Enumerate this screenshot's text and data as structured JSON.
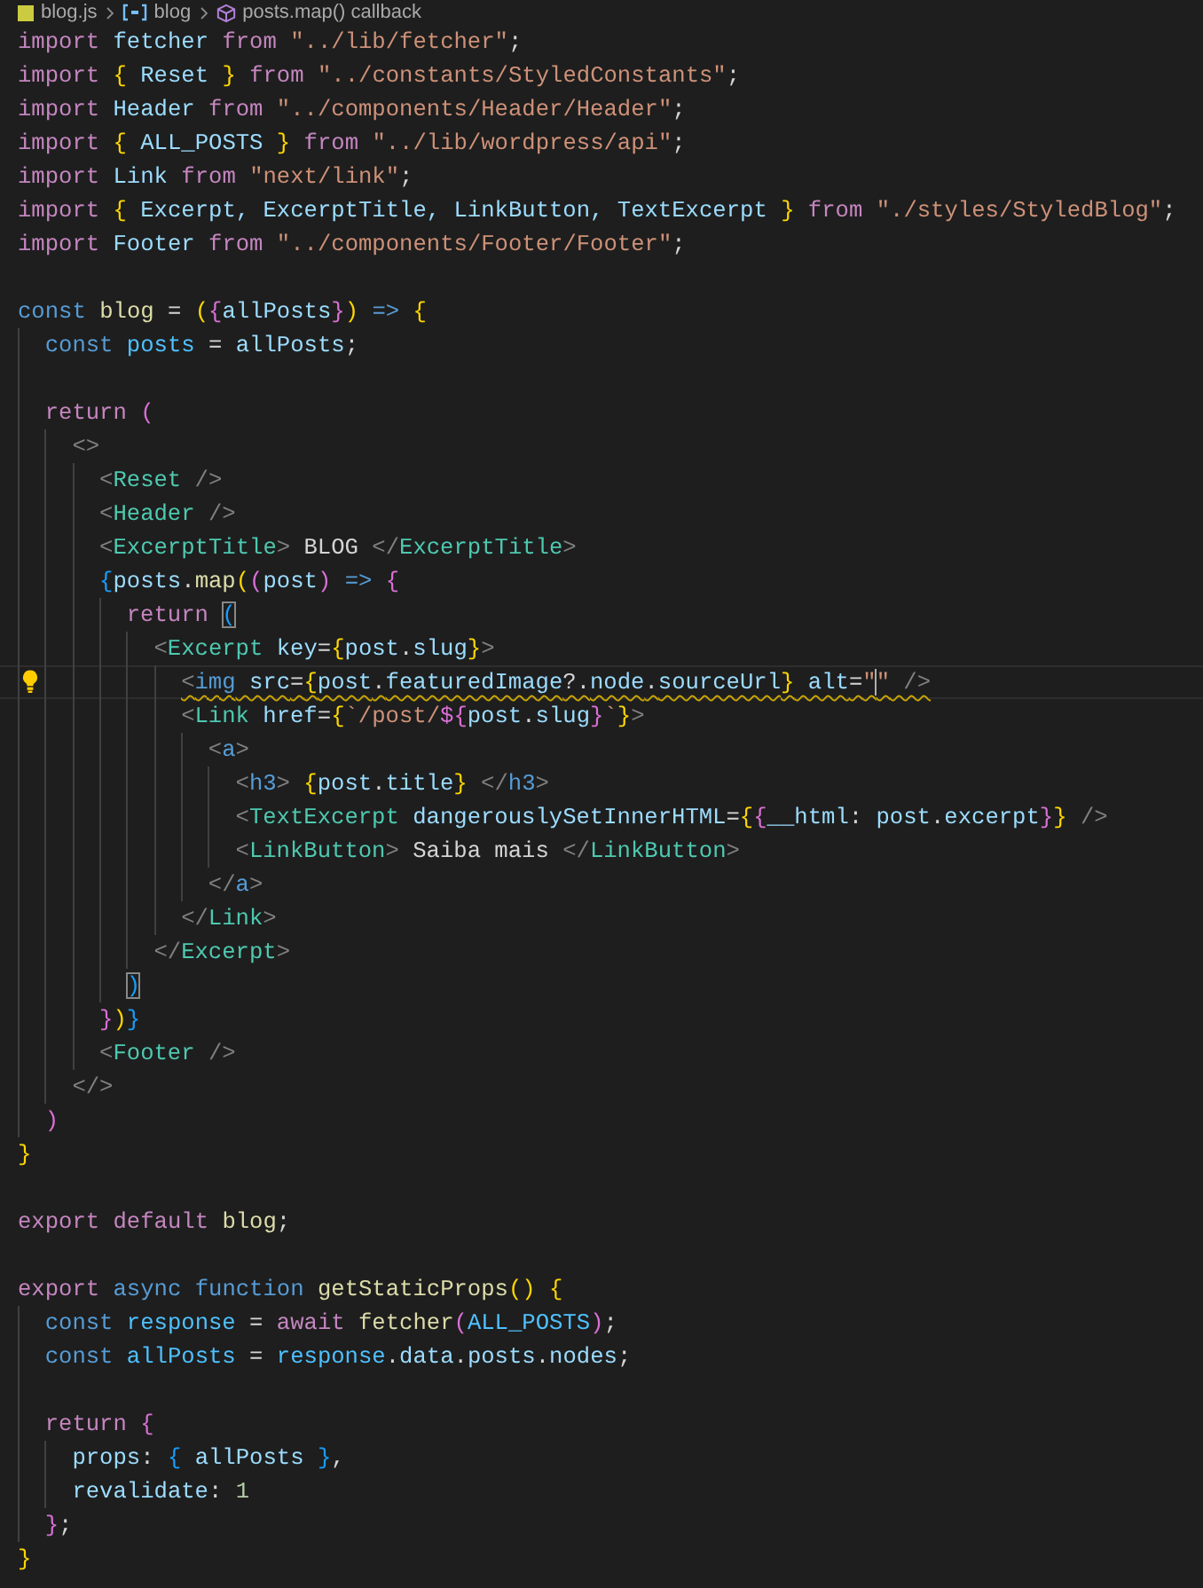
{
  "breadcrumb": [
    {
      "label": "blog.js",
      "kind": "file"
    },
    {
      "label": "blog",
      "kind": "variable"
    },
    {
      "label": "posts.map() callback",
      "kind": "method"
    }
  ],
  "lines": [
    {
      "kind": "code",
      "tokens": [
        {
          "text": "import",
          "kind": "kw"
        },
        {
          "text": " fetcher",
          "kind": "v"
        },
        {
          "text": " from",
          "kind": "kw"
        },
        {
          "text": " \"../lib/fetcher\"",
          "kind": "s"
        },
        {
          "text": ";",
          "kind": "p"
        }
      ]
    },
    {
      "kind": "code",
      "tokens": [
        {
          "text": "import",
          "kind": "kw"
        },
        {
          "text": " {",
          "kind": "b1"
        },
        {
          "text": " Reset ",
          "kind": "v"
        },
        {
          "text": "}",
          "kind": "b1"
        },
        {
          "text": " from",
          "kind": "kw"
        },
        {
          "text": " \"../constants/StyledConstants\"",
          "kind": "s"
        },
        {
          "text": ";",
          "kind": "p"
        }
      ]
    },
    {
      "kind": "code",
      "tokens": [
        {
          "text": "import",
          "kind": "kw"
        },
        {
          "text": " Header",
          "kind": "v"
        },
        {
          "text": " from",
          "kind": "kw"
        },
        {
          "text": " \"../components/Header/Header\"",
          "kind": "s"
        },
        {
          "text": ";",
          "kind": "p"
        }
      ]
    },
    {
      "kind": "code",
      "tokens": [
        {
          "text": "import",
          "kind": "kw"
        },
        {
          "text": " {",
          "kind": "b1"
        },
        {
          "text": " ALL_POSTS ",
          "kind": "v"
        },
        {
          "text": "}",
          "kind": "b1"
        },
        {
          "text": " from",
          "kind": "kw"
        },
        {
          "text": " \"../lib/wordpress/api\"",
          "kind": "s"
        },
        {
          "text": ";",
          "kind": "p"
        }
      ]
    },
    {
      "kind": "code",
      "tokens": [
        {
          "text": "import",
          "kind": "kw"
        },
        {
          "text": " Link",
          "kind": "v"
        },
        {
          "text": " from",
          "kind": "kw"
        },
        {
          "text": " \"next/link\"",
          "kind": "s"
        },
        {
          "text": ";",
          "kind": "p"
        }
      ]
    },
    {
      "kind": "code",
      "tokens": [
        {
          "text": "import",
          "kind": "kw"
        },
        {
          "text": " {",
          "kind": "b1"
        },
        {
          "text": " Excerpt, ExcerptTitle, LinkButton, TextExcerpt ",
          "kind": "v"
        },
        {
          "text": "}",
          "kind": "b1"
        },
        {
          "text": " from",
          "kind": "kw"
        },
        {
          "text": " \"./styles/StyledBlog\"",
          "kind": "s"
        },
        {
          "text": ";",
          "kind": "p"
        }
      ]
    },
    {
      "kind": "code",
      "tokens": [
        {
          "text": "import",
          "kind": "kw"
        },
        {
          "text": " Footer",
          "kind": "v"
        },
        {
          "text": " from",
          "kind": "kw"
        },
        {
          "text": " \"../components/Footer/Footer\"",
          "kind": "s"
        },
        {
          "text": ";",
          "kind": "p"
        }
      ]
    },
    {
      "kind": "blank"
    },
    {
      "kind": "code",
      "tokens": [
        {
          "text": "const",
          "kind": "decl"
        },
        {
          "text": " blog",
          "kind": "fn"
        },
        {
          "text": " =",
          "kind": "p"
        },
        {
          "text": " (",
          "kind": "b1"
        },
        {
          "text": "{",
          "kind": "b2"
        },
        {
          "text": "allPosts",
          "kind": "v"
        },
        {
          "text": "}",
          "kind": "b2"
        },
        {
          "text": ")",
          "kind": "b1"
        },
        {
          "text": " =>",
          "kind": "decl"
        },
        {
          "text": " {",
          "kind": "b1"
        }
      ]
    },
    {
      "kind": "code",
      "tokens": [
        {
          "text": "  const",
          "kind": "decl"
        },
        {
          "text": " posts",
          "kind": "k"
        },
        {
          "text": " =",
          "kind": "p"
        },
        {
          "text": " allPosts",
          "kind": "v"
        },
        {
          "text": ";",
          "kind": "p"
        }
      ]
    },
    {
      "kind": "blank"
    },
    {
      "kind": "code",
      "tokens": [
        {
          "text": "  return",
          "kind": "kw"
        },
        {
          "text": " (",
          "kind": "b2"
        }
      ]
    },
    {
      "kind": "code",
      "tokens": [
        {
          "text": "    <>",
          "kind": "tp"
        }
      ]
    },
    {
      "kind": "code",
      "tokens": [
        {
          "text": "      <",
          "kind": "tp"
        },
        {
          "text": "Reset",
          "kind": "c"
        },
        {
          "text": " />",
          "kind": "tp"
        }
      ]
    },
    {
      "kind": "code",
      "tokens": [
        {
          "text": "      <",
          "kind": "tp"
        },
        {
          "text": "Header",
          "kind": "c"
        },
        {
          "text": " />",
          "kind": "tp"
        }
      ]
    },
    {
      "kind": "code",
      "tokens": [
        {
          "text": "      <",
          "kind": "tp"
        },
        {
          "text": "ExcerptTitle",
          "kind": "c"
        },
        {
          "text": ">",
          "kind": "tp"
        },
        {
          "text": " BLOG",
          "kind": "p"
        },
        {
          "text": " </",
          "kind": "tp"
        },
        {
          "text": "ExcerptTitle",
          "kind": "c"
        },
        {
          "text": ">",
          "kind": "tp"
        }
      ]
    },
    {
      "kind": "code",
      "tokens": [
        {
          "text": "      {",
          "kind": "b3"
        },
        {
          "text": "posts",
          "kind": "v"
        },
        {
          "text": ".",
          "kind": "p"
        },
        {
          "text": "map",
          "kind": "fn"
        },
        {
          "text": "(",
          "kind": "b1"
        },
        {
          "text": "(",
          "kind": "b2"
        },
        {
          "text": "post",
          "kind": "v"
        },
        {
          "text": ")",
          "kind": "b2"
        },
        {
          "text": " =>",
          "kind": "decl"
        },
        {
          "text": " {",
          "kind": "b2"
        }
      ]
    },
    {
      "kind": "code",
      "tokens": [
        {
          "text": "        return ",
          "kind": "kw"
        },
        {
          "text": "(",
          "kind": "b3",
          "matched": true
        }
      ]
    },
    {
      "kind": "code",
      "tokens": [
        {
          "text": "          <",
          "kind": "tp"
        },
        {
          "text": "Excerpt",
          "kind": "c"
        },
        {
          "text": " key",
          "kind": "v"
        },
        {
          "text": "=",
          "kind": "p"
        },
        {
          "text": "{",
          "kind": "b1"
        },
        {
          "text": "post",
          "kind": "v"
        },
        {
          "text": ".",
          "kind": "p"
        },
        {
          "text": "slug",
          "kind": "v"
        },
        {
          "text": "}",
          "kind": "b1"
        },
        {
          "text": ">",
          "kind": "tp"
        }
      ]
    },
    {
      "kind": "code",
      "current": true,
      "lightbulb": true,
      "warning": true,
      "tokens": [
        {
          "text": "            <",
          "kind": "tp"
        },
        {
          "text": "img",
          "kind": "h"
        },
        {
          "text": " src",
          "kind": "v"
        },
        {
          "text": "=",
          "kind": "p"
        },
        {
          "text": "{",
          "kind": "b1"
        },
        {
          "text": "post",
          "kind": "v"
        },
        {
          "text": ".",
          "kind": "p"
        },
        {
          "text": "featuredImage",
          "kind": "v"
        },
        {
          "text": "?.",
          "kind": "p"
        },
        {
          "text": "node",
          "kind": "v"
        },
        {
          "text": ".",
          "kind": "p"
        },
        {
          "text": "sourceUrl",
          "kind": "v"
        },
        {
          "text": "}",
          "kind": "b1"
        },
        {
          "text": " alt",
          "kind": "v"
        },
        {
          "text": "=",
          "kind": "p"
        },
        {
          "text": "\"",
          "kind": "s",
          "caret": true
        },
        {
          "text": "\"",
          "kind": "s"
        },
        {
          "text": " />",
          "kind": "tp"
        }
      ]
    },
    {
      "kind": "code",
      "tokens": [
        {
          "text": "            <",
          "kind": "tp"
        },
        {
          "text": "Link",
          "kind": "c"
        },
        {
          "text": " href",
          "kind": "v"
        },
        {
          "text": "=",
          "kind": "p"
        },
        {
          "text": "{",
          "kind": "b1"
        },
        {
          "text": "`/post/",
          "kind": "s"
        },
        {
          "text": "${",
          "kind": "b2"
        },
        {
          "text": "post",
          "kind": "v"
        },
        {
          "text": ".",
          "kind": "p"
        },
        {
          "text": "slug",
          "kind": "v"
        },
        {
          "text": "}",
          "kind": "b2"
        },
        {
          "text": "`",
          "kind": "s"
        },
        {
          "text": "}",
          "kind": "b1"
        },
        {
          "text": ">",
          "kind": "tp"
        }
      ]
    },
    {
      "kind": "code",
      "tokens": [
        {
          "text": "              <",
          "kind": "tp"
        },
        {
          "text": "a",
          "kind": "h"
        },
        {
          "text": ">",
          "kind": "tp"
        }
      ]
    },
    {
      "kind": "code",
      "tokens": [
        {
          "text": "                <",
          "kind": "tp"
        },
        {
          "text": "h3",
          "kind": "h"
        },
        {
          "text": ">",
          "kind": "tp"
        },
        {
          "text": " {",
          "kind": "b1"
        },
        {
          "text": "post",
          "kind": "v"
        },
        {
          "text": ".",
          "kind": "p"
        },
        {
          "text": "title",
          "kind": "v"
        },
        {
          "text": "}",
          "kind": "b1"
        },
        {
          "text": " </",
          "kind": "tp"
        },
        {
          "text": "h3",
          "kind": "h"
        },
        {
          "text": ">",
          "kind": "tp"
        }
      ]
    },
    {
      "kind": "code",
      "tokens": [
        {
          "text": "                <",
          "kind": "tp"
        },
        {
          "text": "TextExcerpt",
          "kind": "c"
        },
        {
          "text": " dangerouslySetInnerHTML",
          "kind": "v"
        },
        {
          "text": "=",
          "kind": "p"
        },
        {
          "text": "{",
          "kind": "b1"
        },
        {
          "text": "{",
          "kind": "b2"
        },
        {
          "text": "__html",
          "kind": "v"
        },
        {
          "text": ":",
          "kind": "p"
        },
        {
          "text": " post",
          "kind": "v"
        },
        {
          "text": ".",
          "kind": "p"
        },
        {
          "text": "excerpt",
          "kind": "v"
        },
        {
          "text": "}",
          "kind": "b2"
        },
        {
          "text": "}",
          "kind": "b1"
        },
        {
          "text": " />",
          "kind": "tp"
        }
      ]
    },
    {
      "kind": "code",
      "tokens": [
        {
          "text": "                <",
          "kind": "tp"
        },
        {
          "text": "LinkButton",
          "kind": "c"
        },
        {
          "text": ">",
          "kind": "tp"
        },
        {
          "text": " Saiba mais",
          "kind": "p"
        },
        {
          "text": " </",
          "kind": "tp"
        },
        {
          "text": "LinkButton",
          "kind": "c"
        },
        {
          "text": ">",
          "kind": "tp"
        }
      ]
    },
    {
      "kind": "code",
      "tokens": [
        {
          "text": "              </",
          "kind": "tp"
        },
        {
          "text": "a",
          "kind": "h"
        },
        {
          "text": ">",
          "kind": "tp"
        }
      ]
    },
    {
      "kind": "code",
      "tokens": [
        {
          "text": "            </",
          "kind": "tp"
        },
        {
          "text": "Link",
          "kind": "c"
        },
        {
          "text": ">",
          "kind": "tp"
        }
      ]
    },
    {
      "kind": "code",
      "tokens": [
        {
          "text": "          </",
          "kind": "tp"
        },
        {
          "text": "Excerpt",
          "kind": "c"
        },
        {
          "text": ">",
          "kind": "tp"
        }
      ]
    },
    {
      "kind": "code",
      "tokens": [
        {
          "text": "        )",
          "kind": "b3",
          "matched": true
        }
      ]
    },
    {
      "kind": "code",
      "tokens": [
        {
          "text": "      }",
          "kind": "b2"
        },
        {
          "text": ")",
          "kind": "b1"
        },
        {
          "text": "}",
          "kind": "b3"
        }
      ]
    },
    {
      "kind": "code",
      "tokens": [
        {
          "text": "      <",
          "kind": "tp"
        },
        {
          "text": "Footer",
          "kind": "c"
        },
        {
          "text": " />",
          "kind": "tp"
        }
      ]
    },
    {
      "kind": "code",
      "tokens": [
        {
          "text": "    </>",
          "kind": "tp"
        }
      ]
    },
    {
      "kind": "code",
      "tokens": [
        {
          "text": "  )",
          "kind": "b2"
        }
      ]
    },
    {
      "kind": "code",
      "tokens": [
        {
          "text": "}",
          "kind": "b1"
        }
      ]
    },
    {
      "kind": "blank"
    },
    {
      "kind": "code",
      "tokens": [
        {
          "text": "export",
          "kind": "kw"
        },
        {
          "text": " default",
          "kind": "kw"
        },
        {
          "text": " blog",
          "kind": "fn"
        },
        {
          "text": ";",
          "kind": "p"
        }
      ]
    },
    {
      "kind": "blank"
    },
    {
      "kind": "code",
      "tokens": [
        {
          "text": "export",
          "kind": "kw"
        },
        {
          "text": " async",
          "kind": "decl"
        },
        {
          "text": " function",
          "kind": "decl"
        },
        {
          "text": " getStaticProps",
          "kind": "fn"
        },
        {
          "text": "()",
          "kind": "b1"
        },
        {
          "text": " {",
          "kind": "b1"
        }
      ]
    },
    {
      "kind": "code",
      "tokens": [
        {
          "text": "  const",
          "kind": "decl"
        },
        {
          "text": " response",
          "kind": "k"
        },
        {
          "text": " =",
          "kind": "p"
        },
        {
          "text": " await",
          "kind": "kw"
        },
        {
          "text": " fetcher",
          "kind": "fn"
        },
        {
          "text": "(",
          "kind": "b2"
        },
        {
          "text": "ALL_POSTS",
          "kind": "k"
        },
        {
          "text": ")",
          "kind": "b2"
        },
        {
          "text": ";",
          "kind": "p"
        }
      ]
    },
    {
      "kind": "code",
      "tokens": [
        {
          "text": "  const",
          "kind": "decl"
        },
        {
          "text": " allPosts",
          "kind": "k"
        },
        {
          "text": " =",
          "kind": "p"
        },
        {
          "text": " response",
          "kind": "k"
        },
        {
          "text": ".",
          "kind": "p"
        },
        {
          "text": "data",
          "kind": "v"
        },
        {
          "text": ".",
          "kind": "p"
        },
        {
          "text": "posts",
          "kind": "v"
        },
        {
          "text": ".",
          "kind": "p"
        },
        {
          "text": "nodes",
          "kind": "v"
        },
        {
          "text": ";",
          "kind": "p"
        }
      ]
    },
    {
      "kind": "blank"
    },
    {
      "kind": "code",
      "tokens": [
        {
          "text": "  return",
          "kind": "kw"
        },
        {
          "text": " {",
          "kind": "b2"
        }
      ]
    },
    {
      "kind": "code",
      "tokens": [
        {
          "text": "    props",
          "kind": "v"
        },
        {
          "text": ":",
          "kind": "p"
        },
        {
          "text": " {",
          "kind": "b3"
        },
        {
          "text": " allPosts ",
          "kind": "v"
        },
        {
          "text": "}",
          "kind": "b3"
        },
        {
          "text": ",",
          "kind": "p"
        }
      ]
    },
    {
      "kind": "code",
      "tokens": [
        {
          "text": "    revalidate",
          "kind": "v"
        },
        {
          "text": ":",
          "kind": "p"
        },
        {
          "text": " 1",
          "kind": "n"
        }
      ]
    },
    {
      "kind": "code",
      "tokens": [
        {
          "text": "  }",
          "kind": "b2"
        },
        {
          "text": ";",
          "kind": "p"
        }
      ]
    },
    {
      "kind": "code",
      "tokens": [
        {
          "text": "}",
          "kind": "b1"
        }
      ]
    }
  ]
}
